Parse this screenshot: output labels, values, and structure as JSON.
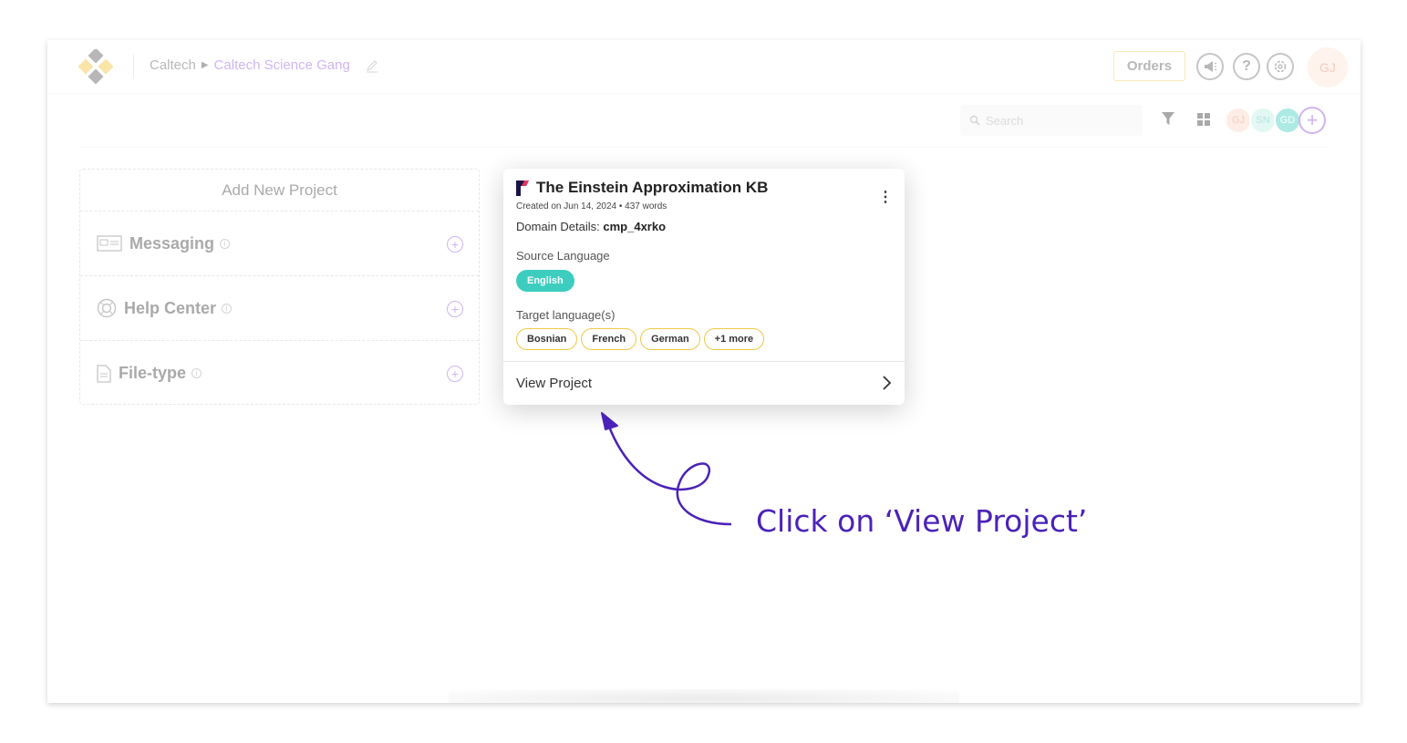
{
  "header": {
    "org": "Caltech",
    "project": "Caltech Science Gang",
    "orders_label": "Orders",
    "icons": [
      "announcement-icon",
      "help-icon",
      "settings-icon"
    ],
    "user_initials": "GJ"
  },
  "toolbar": {
    "search_placeholder": "Search",
    "members": [
      {
        "initials": "GJ",
        "color": "#fbd5c3"
      },
      {
        "initials": "SN",
        "color": "#bdeee6"
      },
      {
        "initials": "GD",
        "color": "#3ccdbf"
      }
    ]
  },
  "add_panel": {
    "title": "Add New Project",
    "items": [
      {
        "label": "Messaging"
      },
      {
        "label": "Help Center"
      },
      {
        "label": "File-type"
      }
    ]
  },
  "card": {
    "title": "The Einstein Approximation KB",
    "created": "Created on Jun 14, 2024",
    "words": "437 words",
    "domain_label": "Domain Details:",
    "domain_value": "cmp_4xrko",
    "source_label": "Source Language",
    "source_language": "English",
    "target_label": "Target language(s)",
    "targets": [
      "Bosnian",
      "French",
      "German",
      "+1 more"
    ],
    "view_label": "View Project"
  },
  "annotation": {
    "text": "Click on ‘View Project’"
  },
  "colors": {
    "accent": "#8b4fe0",
    "teal": "#3ccdbf",
    "yellow_border": "#f0c848",
    "annotation": "#4b22b8"
  }
}
